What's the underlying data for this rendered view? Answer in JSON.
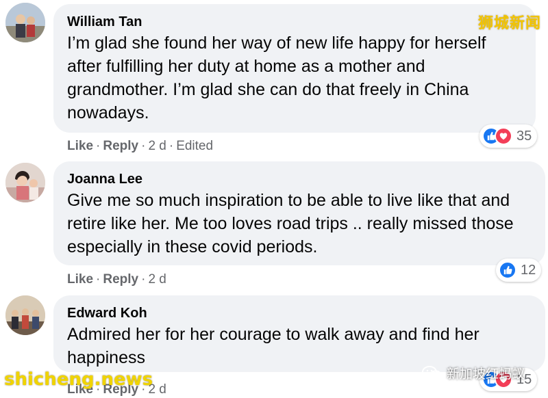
{
  "watermarks": {
    "top_right": "狮城新闻",
    "bottom_left": "shicheng.news",
    "bottom_right": "新加坡红蚂蚁"
  },
  "comments": [
    {
      "author": "William Tan",
      "text": "I’m glad she found her way of new life happy for herself after fulfilling her duty at home as a mother and grandmother. I’m glad she can do that freely in China nowadays.",
      "like_label": "Like",
      "reply_label": "Reply",
      "time": "2 d",
      "edited": "Edited",
      "reactions": [
        "like",
        "love"
      ],
      "reaction_count": "35"
    },
    {
      "author": "Joanna Lee",
      "text": "Give me so much inspiration to be able to live like that and retire like her. Me too loves road trips .. really missed those especially in these covid periods.",
      "like_label": "Like",
      "reply_label": "Reply",
      "time": "2 d",
      "reactions": [
        "like"
      ],
      "reaction_count": "12"
    },
    {
      "author": "Edward Koh",
      "text": "Admired her for her courage to walk away and find her happiness",
      "like_label": "Like",
      "reply_label": "Reply",
      "time": "2 d",
      "reactions": [
        "like",
        "love"
      ],
      "reaction_count": "15"
    }
  ],
  "separator": "·",
  "colors": {
    "bubble": "#f0f2f5",
    "meta_text": "#65676b",
    "like_blue": "#1877f2",
    "love_red": "#f33e58",
    "watermark_yellow": "#f2c400"
  }
}
